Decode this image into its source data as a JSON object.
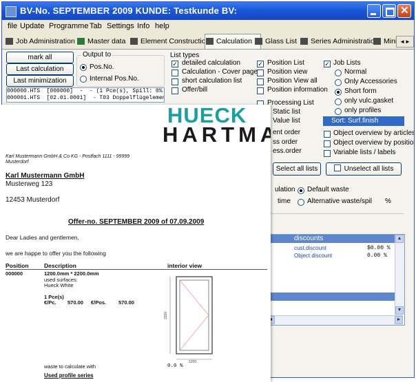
{
  "window": {
    "title": "BV-No. SEPTEMBER 2009  KUNDE: Testkunde  BV:"
  },
  "menu": [
    "file",
    "Update",
    "Programme",
    "Tab",
    "Settings",
    "Info",
    "help"
  ],
  "tabs": [
    "Job Administration",
    "Master data",
    "Element Construction",
    "Calculation",
    "Glass List",
    "Series Administration",
    "Minim"
  ],
  "active_tab": "Calculation",
  "left": {
    "mark_all": "mark all",
    "last_calc": "Last calculation",
    "last_min": "Last minimization",
    "output_to": {
      "title": "Output to",
      "options": [
        "Pos.No.",
        "Internal Pos.No."
      ],
      "selected": "Pos.No."
    },
    "log_lines": [
      "000000.HTS  [000000]  -  - (1 Pce(s), Spill: 0%",
      "000001.HTS  [02.01.0001]  - T03 Doppelflügelemen"
    ]
  },
  "list_types": {
    "title": "List types",
    "col1": [
      {
        "label": "detailed calculation",
        "checked": true
      },
      {
        "label": "Calculation - Cover page",
        "checked": false
      },
      {
        "label": "short calculation list",
        "checked": false
      },
      {
        "label": "Offer/bill",
        "checked": false
      }
    ],
    "col2": [
      {
        "label": "Position List",
        "checked": true
      },
      {
        "label": "Position view",
        "checked": false
      },
      {
        "label": "Position View all",
        "checked": false
      },
      {
        "label": "Position information",
        "checked": false
      },
      {
        "label": "Processing List",
        "checked": false
      },
      {
        "label": "Static list",
        "checked": false
      },
      {
        "label": "Value list",
        "checked": false
      },
      {
        "label": "ent order",
        "checked": false
      },
      {
        "label": "ss order",
        "checked": false
      },
      {
        "label": "ess.order",
        "checked": false
      }
    ]
  },
  "job_lists": {
    "title": "Job Lists",
    "checked": true,
    "options": [
      "Normal",
      "Only Accessories",
      "Short form",
      "only vulc.gasket",
      "only profiles"
    ],
    "selected": "Short form",
    "sort": "Sort:  Surf.finish"
  },
  "object_opts": [
    {
      "label": "Object overview by articles",
      "checked": false
    },
    {
      "label": "Object overview by positions",
      "checked": false
    },
    {
      "label": "Variable lists / labels",
      "checked": false
    }
  ],
  "buttons": {
    "select_all": "Select all lists",
    "unselect_all": "Unselect all lists"
  },
  "waste": {
    "row1_prefix": "ulation",
    "default": "Default waste",
    "row2_prefix": "time",
    "alternative": "Alternative waste/spil",
    "unit": "%"
  },
  "discounts": {
    "header": "discounts",
    "rows": [
      {
        "label": "cust.discount",
        "value": "$0.00 %"
      },
      {
        "label": "Object discount",
        "value": "0.00 %"
      }
    ]
  },
  "doc": {
    "logo_top": "HUECK",
    "logo_bottom": "HARTMANN",
    "sender": "Karl Mustermann GmbH & Co KG - Postfach 1111 - 99999",
    "sender_city": "Musterdorf",
    "recipient_name": "Karl Mustermann GmbH",
    "recipient_street": "Musterweg 123",
    "recipient_city": "12453 Musterdorf",
    "offer_title": "Offer-no.  SEPTEMBER 2009 of 07.09.2009",
    "greeting": "Dear Ladies and gentlemen,",
    "intro": "we are happe to offer you the following",
    "col_position": "Position",
    "col_description": "Description",
    "col_interior": "interior view",
    "pos_no": "000000",
    "dims": "1200.0mm * 2200.0mm",
    "surfaces_label": "used surfaces:",
    "surface": "Hueck White",
    "qty": "1 Pce(s)",
    "price_pc_label": "€/Pc.",
    "price_pc": "570.00",
    "price_pos_label": "€/Pos.",
    "price_pos": "570.00",
    "drawing_width": "1200",
    "drawing_height": "2200",
    "waste_label": "waste to calculate with",
    "waste_value": "0.0 %",
    "profile_series": "Used profile series"
  }
}
